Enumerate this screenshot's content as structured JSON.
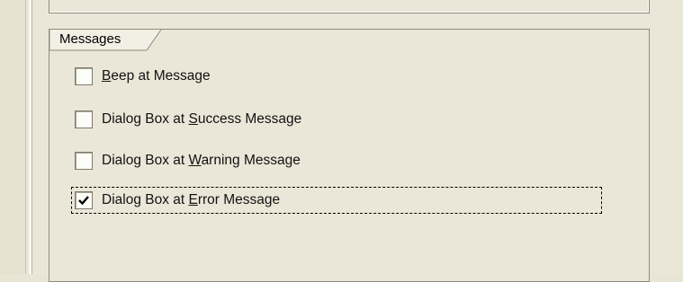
{
  "group": {
    "title": "Messages"
  },
  "options": [
    {
      "prefix": "",
      "accel": "B",
      "suffix": "eep at Message",
      "checked": false
    },
    {
      "prefix": "Dialog Box at ",
      "accel": "S",
      "suffix": "uccess Message",
      "checked": false
    },
    {
      "prefix": "Dialog Box at ",
      "accel": "W",
      "suffix": "arning Message",
      "checked": false
    },
    {
      "prefix": "Dialog Box at ",
      "accel": "E",
      "suffix": "rror Message",
      "checked": true
    }
  ]
}
